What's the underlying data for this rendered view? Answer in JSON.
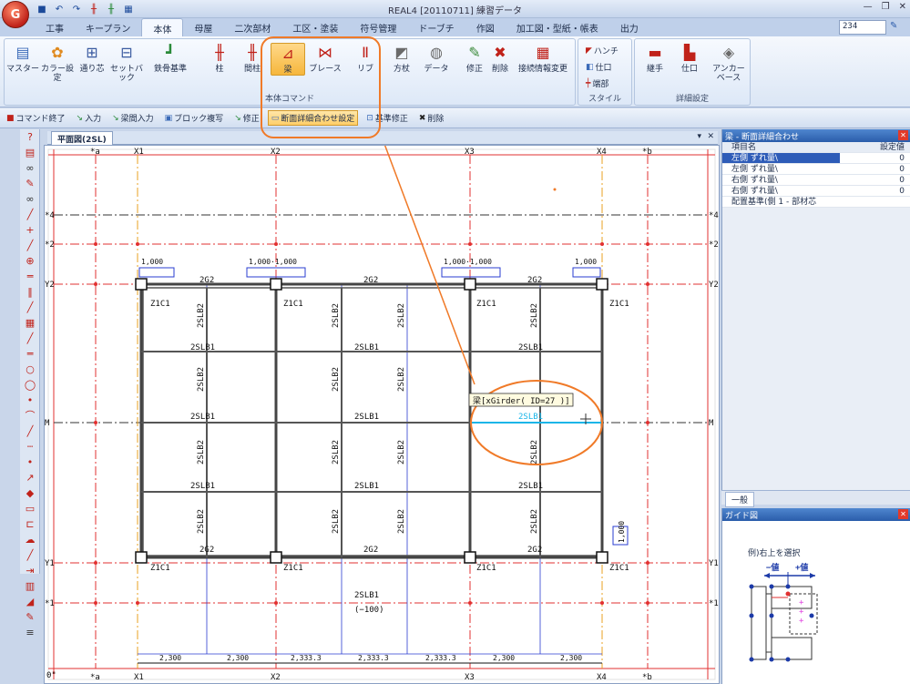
{
  "app": {
    "title": "REAL4 [20110711] 練習データ",
    "logo_text": "G",
    "search_value": "234"
  },
  "tabs": [
    "工事",
    "キープラン",
    "本体",
    "母屋",
    "二次部材",
    "工区・塗装",
    "符号管理",
    "ドーブチ",
    "作図",
    "加工図・型紙・帳表",
    "出力"
  ],
  "active_tab": 2,
  "ribbon": {
    "group1": {
      "label": "本体コマンド",
      "buttons": [
        "マスター",
        "カラー設定",
        "通り芯",
        "セットバック",
        "鉄骨基準",
        "柱",
        "間柱",
        "梁",
        "ブレース",
        "リブ",
        "方杖",
        "データ",
        "修正",
        "削除",
        "接続情報変更"
      ]
    },
    "group2": {
      "label": "スタイル",
      "items": [
        "ハンチ",
        "仕口",
        "端部"
      ]
    },
    "group3": {
      "label": "詳細設定",
      "buttons": [
        "継手",
        "仕口",
        "アンカーベース"
      ]
    }
  },
  "cmdbar": [
    "コマンド終了",
    "入力",
    "梁間入力",
    "ブロック複写",
    "修正",
    "断面詳細合わせ設定",
    "基準修正",
    "削除"
  ],
  "drawing": {
    "tab_label": "平面図(2SL)",
    "x_grid": [
      "*a",
      "X1",
      "X2",
      "X3",
      "X4",
      "*b"
    ],
    "y_grid": [
      "*4",
      "*2",
      "Y2",
      "M",
      "Y1",
      "*1"
    ],
    "top_dims": [
      "1,000",
      "1,000·1,000",
      "1,000·1,000",
      "1,000"
    ],
    "bottom_dims": [
      "2,300",
      "2,300",
      "2,333.3",
      "2,333.3",
      "2,333.3",
      "2,300",
      "2,300"
    ],
    "girder_top": [
      "2G2",
      "2G2",
      "2G2"
    ],
    "girder_bottom": [
      "2G2",
      "2G2",
      "2G2"
    ],
    "column_labels": [
      "Z1C1",
      "Z1C1",
      "Z1C1",
      "Z1C1",
      "Z1C1",
      "Z1C1",
      "Z1C1",
      "Z1C1"
    ],
    "beam_small": "2SLB1",
    "beam_vertical": "2SLB2",
    "tooltip": "梁[xGirder( ID=27 )]",
    "highlight_label": "2SLB1",
    "right_dim": "1,000",
    "bottom_note": "(−100)",
    "bottom_left": "0\""
  },
  "property_panel": {
    "title": "梁 - 断面詳細合わせ",
    "headers": [
      "項目名",
      "設定値"
    ],
    "rows": [
      {
        "name": "左側 ずれ量\\",
        "value": "0"
      },
      {
        "name": "左側 ずれ量\\",
        "value": "0"
      },
      {
        "name": "右側 ずれ量\\",
        "value": "0"
      },
      {
        "name": "右側 ずれ量\\",
        "value": "0"
      },
      {
        "name": "配置基準(側 1 - 部材芯",
        "value": ""
      }
    ],
    "footer_tab": "一般"
  },
  "guide_panel": {
    "title": "ガイド図",
    "text": "例)右上を選択",
    "minus": "−値",
    "plus": "+値"
  },
  "colors": {
    "accent": "#f07a28",
    "grid_red": "#e23030",
    "grid_blue": "#2a3cd0"
  }
}
